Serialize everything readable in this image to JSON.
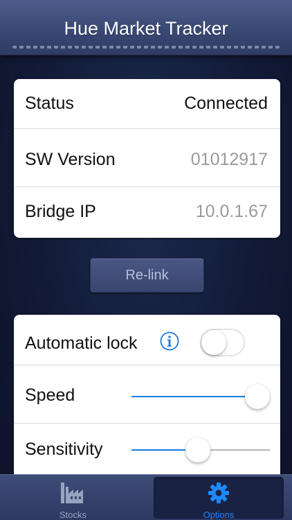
{
  "header": {
    "title": "Hue Market Tracker"
  },
  "bridge_info": {
    "rows": [
      {
        "label": "Status",
        "value": "Connected"
      },
      {
        "label": "SW Version",
        "value": "01012917"
      },
      {
        "label": "Bridge IP",
        "value": "10.0.1.67"
      }
    ]
  },
  "relink": {
    "label": "Re-link"
  },
  "settings": {
    "automatic_lock": {
      "label": "Automatic lock",
      "icon": "info-icon",
      "enabled": false
    },
    "speed": {
      "label": "Speed",
      "value": 0.91
    },
    "sensitivity": {
      "label": "Sensitivity",
      "value": 0.48
    }
  },
  "tabbar": {
    "tabs": [
      {
        "label": "Stocks",
        "icon": "factory-icon",
        "selected": false
      },
      {
        "label": "Options",
        "icon": "gear-icon",
        "selected": true
      }
    ]
  },
  "colors": {
    "accent": "#1a7be0",
    "value_connected": "#111111",
    "value_muted": "#9a9a9e",
    "tab_inactive": "#9aa3bd",
    "tab_active": "#1e88ff"
  }
}
